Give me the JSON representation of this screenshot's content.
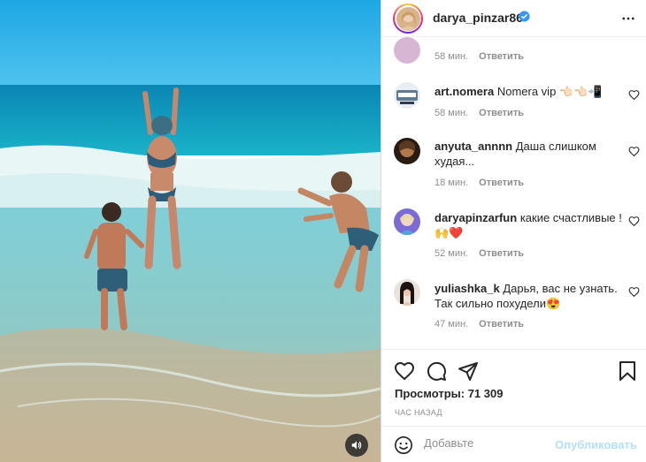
{
  "post": {
    "author": "darya_pinzar86",
    "verified": true,
    "views_label": "Просмотры: 71 309",
    "time_ago": "ЧАС НАЗАД"
  },
  "comments": [
    {
      "username": "",
      "text": "",
      "time": "58 мин.",
      "reply": "Ответить"
    },
    {
      "username": "art.nomera",
      "text": "Nomera vip 👈🏻👈🏻📲",
      "time": "58 мин.",
      "reply": "Ответить"
    },
    {
      "username": "anyuta_annnn",
      "text": "Даша слишком худая...",
      "time": "18 мин.",
      "reply": "Ответить"
    },
    {
      "username": "daryapinzarfun",
      "text": "какие счастливые !🙌❤️",
      "time": "52 мин.",
      "reply": "Ответить"
    },
    {
      "username": "yuliashka_k",
      "text": "Дарья, вас не узнать. Так сильно похудели😍",
      "time": "47 мин.",
      "reply": "Ответить"
    }
  ],
  "add_comment": {
    "placeholder": "Добавьте",
    "post_label": "Опубликовать"
  },
  "icons": {
    "like": "heart-outline-icon",
    "comment": "speech-bubble-icon",
    "share": "paper-plane-icon",
    "save": "bookmark-icon",
    "emoji": "smiley-icon",
    "more": "ellipsis-icon",
    "sound": "speaker-icon"
  },
  "colors": {
    "verified": "#3897f0",
    "link_disabled": "#b2dffc",
    "muted": "#8e8e8e",
    "text": "#262626"
  }
}
